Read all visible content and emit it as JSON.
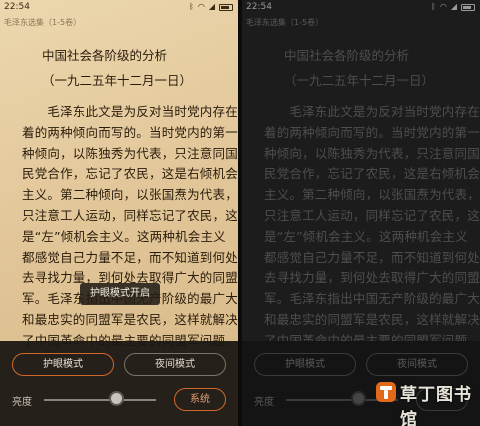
{
  "status": {
    "time": "22:54",
    "icons": [
      "bluetooth-icon",
      "wifi-icon",
      "signal-icon",
      "battery-icon"
    ]
  },
  "book": {
    "title": "毛泽东选集（1-5卷）"
  },
  "article": {
    "heading": "中国社会各阶级的分析",
    "date": "（一九二五年十二月一日）",
    "lines": [
      "　　毛泽东此文是为反对当时党内存在",
      "着的两种倾向而写的。当时党内的第一",
      "种倾向，以陈独秀为代表，只注意同国",
      "民党合作，忘记了农民，这是右倾机会",
      "主义。第二种倾向，以张国焘为代表，",
      "只注意工人运动，同样忘记了农民，这",
      "是“左”倾机会主义。这两种机会主义",
      "都感觉自己力量不足，而不知道到何处",
      "去寻找力量，到何处去取得广大的同盟",
      "军。毛泽东指出中国无产阶级的最广大",
      "和最忠实的同盟军是农民，这样就解决",
      "了中国革命中的最主要的同盟军问题。"
    ]
  },
  "controls": {
    "eye_mode_label": "护眼模式",
    "night_mode_label": "夜间模式",
    "brightness_label": "亮度",
    "brightness_level": 0.65,
    "system_label": "系统"
  },
  "toast": {
    "text": "护眼模式开启"
  },
  "watermark": {
    "text": "草丁图书馆"
  },
  "colors": {
    "accent": "#d0682a",
    "paper": "#e6cca0",
    "night_bg": "#1c1c1c"
  }
}
